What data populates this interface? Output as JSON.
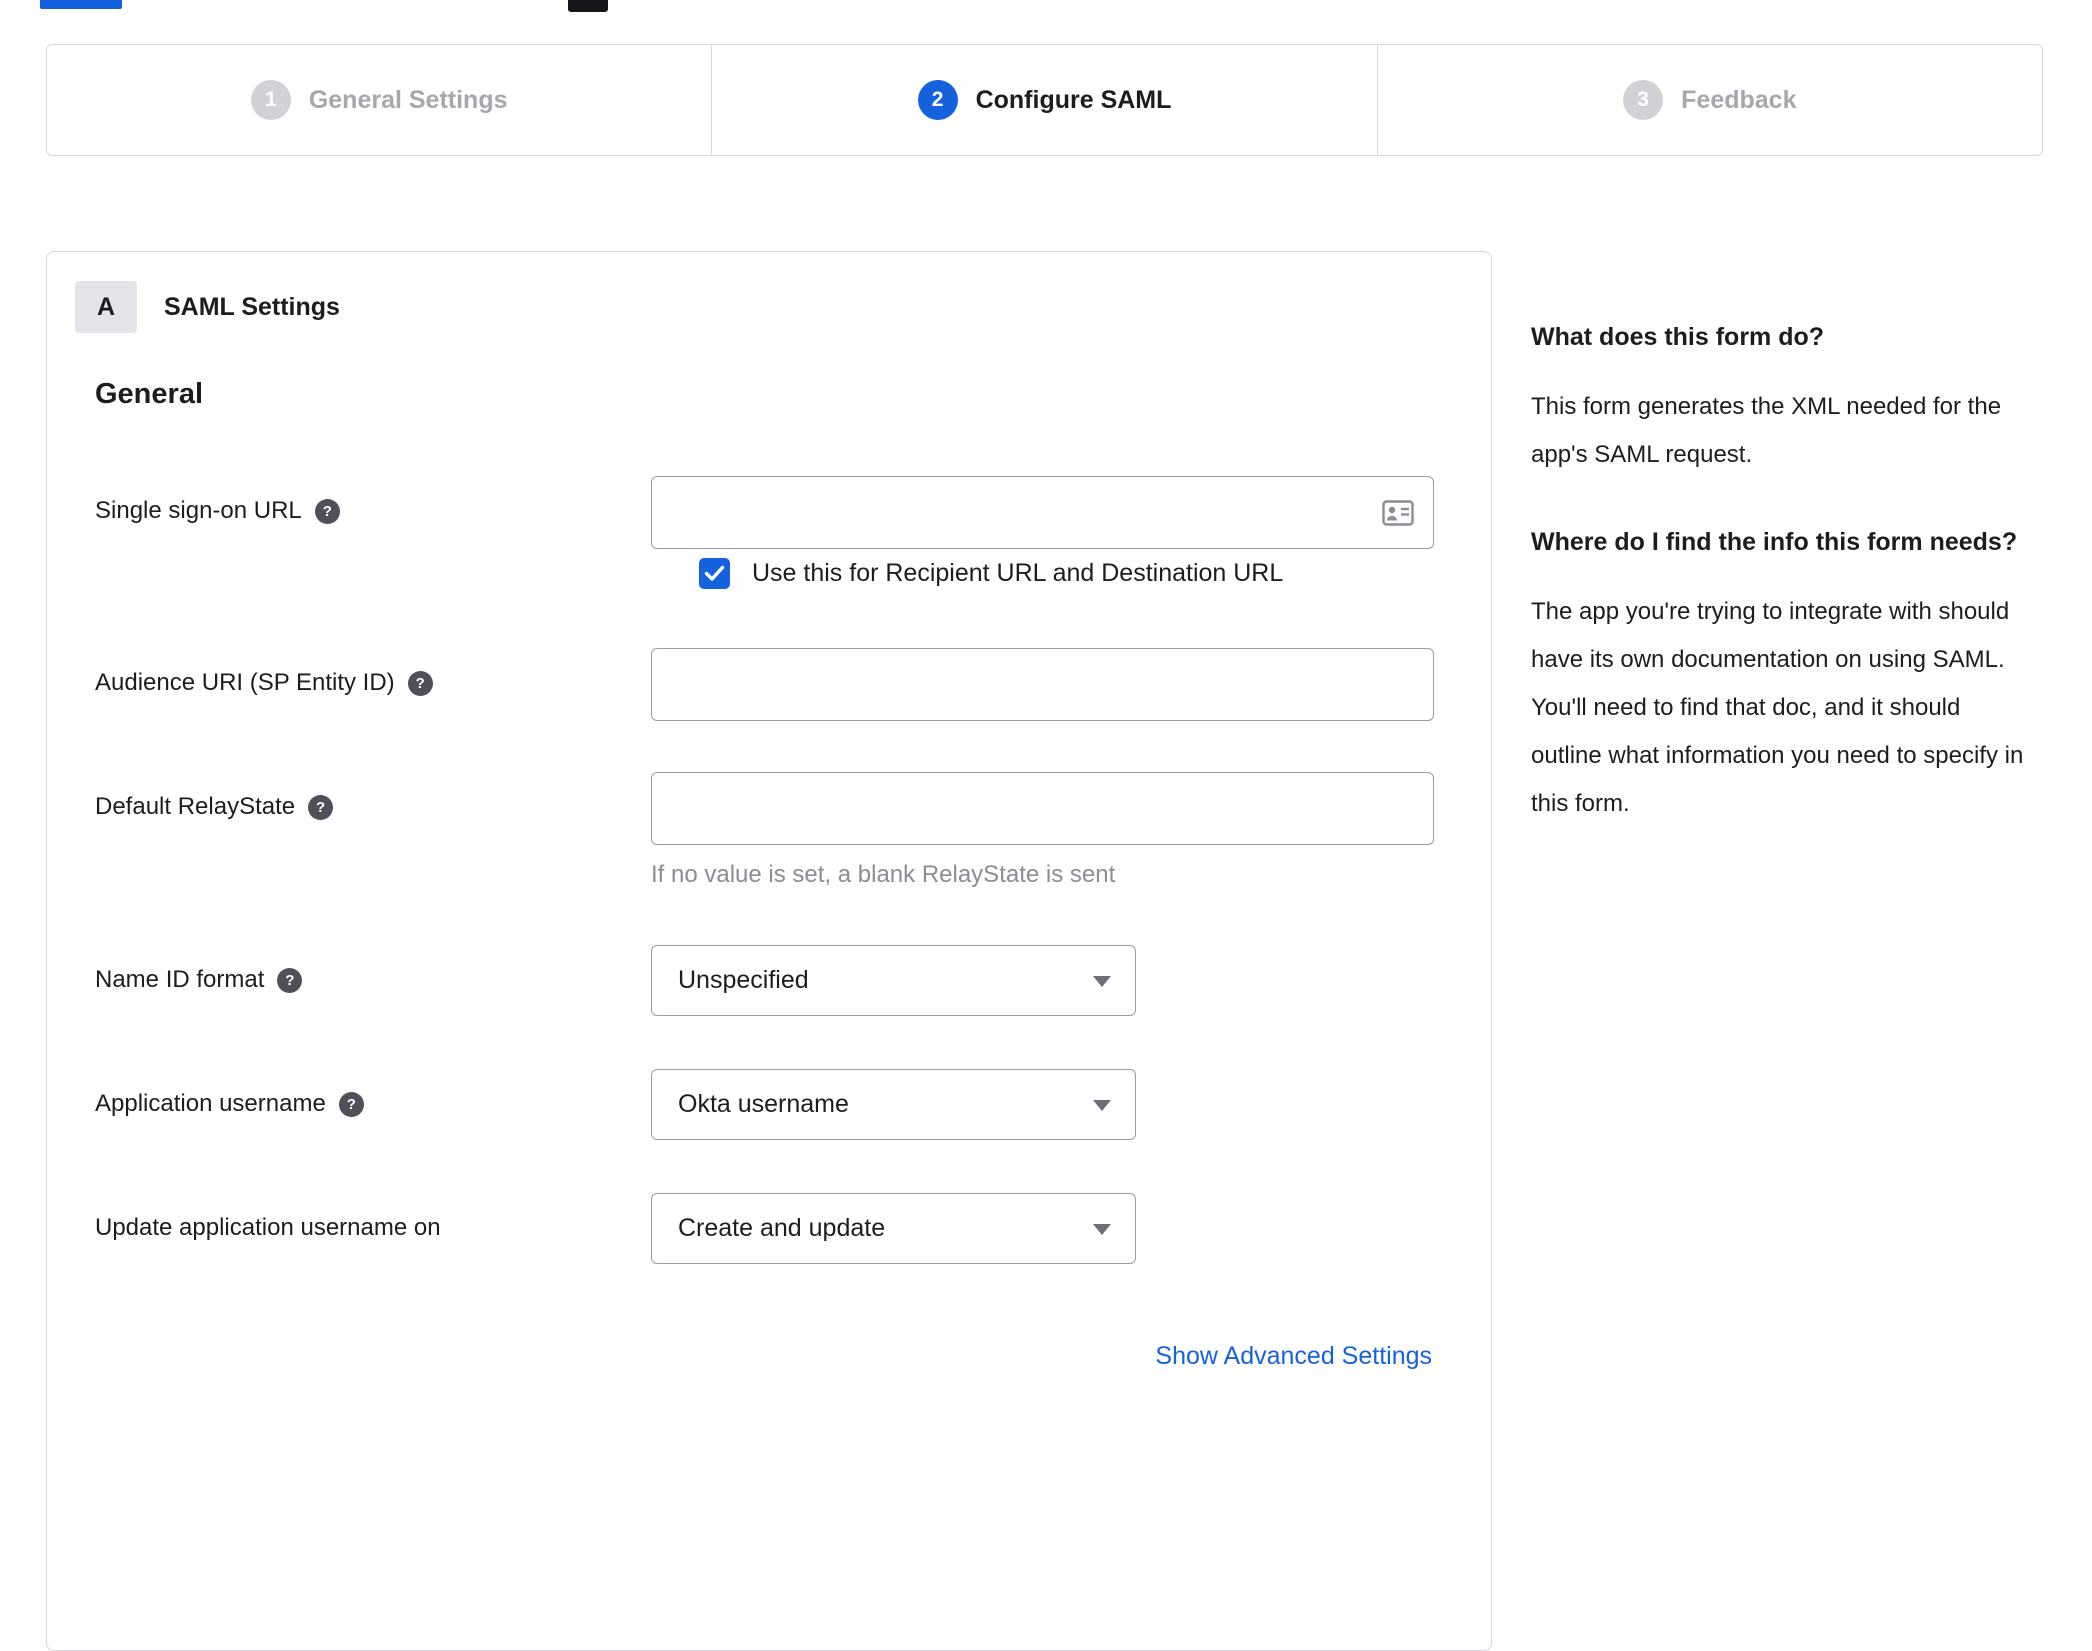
{
  "stepper": {
    "steps": [
      {
        "number": "1",
        "label": "General Settings",
        "state": "inactive"
      },
      {
        "number": "2",
        "label": "Configure SAML",
        "state": "active"
      },
      {
        "number": "3",
        "label": "Feedback",
        "state": "inactive"
      }
    ]
  },
  "panel": {
    "badge": "A",
    "title": "SAML Settings",
    "section_heading": "General",
    "fields": {
      "sso_url": {
        "label": "Single sign-on URL",
        "value": ""
      },
      "sso_checkbox": {
        "label": "Use this for Recipient URL and Destination URL",
        "checked": true
      },
      "audience_uri": {
        "label": "Audience URI (SP Entity ID)",
        "value": ""
      },
      "relay_state": {
        "label": "Default RelayState",
        "value": "",
        "hint": "If no value is set, a blank RelayState is sent"
      },
      "name_id_format": {
        "label": "Name ID format",
        "value": "Unspecified"
      },
      "app_username": {
        "label": "Application username",
        "value": "Okta username"
      },
      "update_app_username": {
        "label": "Update application username on",
        "value": "Create and update"
      }
    },
    "advanced_link": "Show Advanced Settings"
  },
  "sidebar": {
    "sections": [
      {
        "heading": "What does this form do?",
        "body": "This form generates the XML needed for the app's SAML request."
      },
      {
        "heading": "Where do I find the info this form needs?",
        "body": "The app you're trying to integrate with should have its own documentation on using SAML. You'll need to find that doc, and it should outline what information you need to specify in this form."
      }
    ]
  },
  "icons": {
    "help": "?"
  },
  "colors": {
    "accent_blue": "#1662dd",
    "link_blue": "#1662dd",
    "inactive_gray": "#a7a7ae"
  }
}
